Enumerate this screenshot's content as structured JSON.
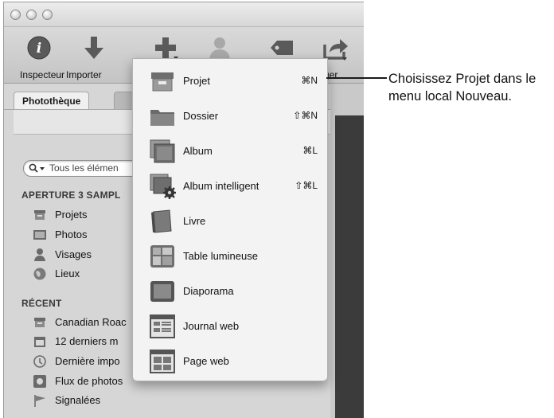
{
  "toolbar": {
    "inspecteur": "Inspecteur",
    "importer": "Importer",
    "partager": "rtager"
  },
  "sidebar": {
    "tab_phototheque": "Photothèque",
    "search_placeholder": "Tous les élémen",
    "section_library": "APERTURE 3 SAMPL",
    "library_items": [
      "Projets",
      "Photos",
      "Visages",
      "Lieux"
    ],
    "section_recent": "RÉCENT",
    "recent_items": [
      "Canadian Roac",
      "12 derniers m",
      "Dernière impo",
      "Flux de photos",
      "Signalées"
    ]
  },
  "menu": {
    "items": [
      {
        "label": "Projet",
        "shortcut": "⌘N"
      },
      {
        "label": "Dossier",
        "shortcut": "⇧⌘N"
      },
      {
        "label": "Album",
        "shortcut": "⌘L"
      },
      {
        "label": "Album intelligent",
        "shortcut": "⇧⌘L"
      },
      {
        "label": "Livre",
        "shortcut": ""
      },
      {
        "label": "Table lumineuse",
        "shortcut": ""
      },
      {
        "label": "Diaporama",
        "shortcut": ""
      },
      {
        "label": "Journal web",
        "shortcut": ""
      },
      {
        "label": "Page web",
        "shortcut": ""
      }
    ]
  },
  "callout": {
    "text": "Choisissez Projet dans le menu local Nouveau."
  },
  "colors": {
    "window_bg": "#d4d4d4",
    "menu_bg": "#f3f3f3",
    "dark_viewer": "#3b3b3b"
  }
}
